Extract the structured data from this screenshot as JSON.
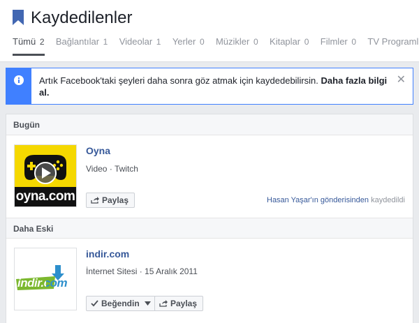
{
  "header": {
    "title": "Kaydedilenler",
    "tabs": [
      {
        "label": "Tümü",
        "count": "2"
      },
      {
        "label": "Bağlantılar",
        "count": "1"
      },
      {
        "label": "Videolar",
        "count": "1"
      },
      {
        "label": "Yerler",
        "count": "0"
      },
      {
        "label": "Müzikler",
        "count": "0"
      },
      {
        "label": "Kitaplar",
        "count": "0"
      },
      {
        "label": "Filmler",
        "count": "0"
      },
      {
        "label": "TV Programları",
        "count": ""
      }
    ]
  },
  "notice": {
    "text": "Artık Facebook'taki şeyleri daha sonra göz atmak için kaydedebilirsin.",
    "link": "Daha fazla bilgi al."
  },
  "sections": {
    "today": {
      "label": "Bugün",
      "item": {
        "title": "Oyna",
        "meta_type": "Video",
        "meta_source": "Twitch",
        "thumb_text": "oyna.com",
        "share_label": "Paylaş",
        "saved_from_link": "Hasan Yaşar'ın gönderisinden",
        "saved_from_suffix": "kaydedildi"
      }
    },
    "older": {
      "label": "Daha Eski",
      "item": {
        "title": "indir.com",
        "meta_type": "İnternet Sitesi",
        "meta_date": "15 Aralık 2011",
        "thumb_text": "indir.com",
        "like_label": "Beğendin",
        "share_label": "Paylaş"
      }
    }
  },
  "colors": {
    "link_blue": "#365899",
    "notice_blue": "#4080ff",
    "oyna_yellow": "#f5d800"
  },
  "icons": [
    "bookmark-icon",
    "info-icon",
    "close-icon",
    "share-icon",
    "check-icon",
    "caret-down-icon",
    "play-icon"
  ]
}
